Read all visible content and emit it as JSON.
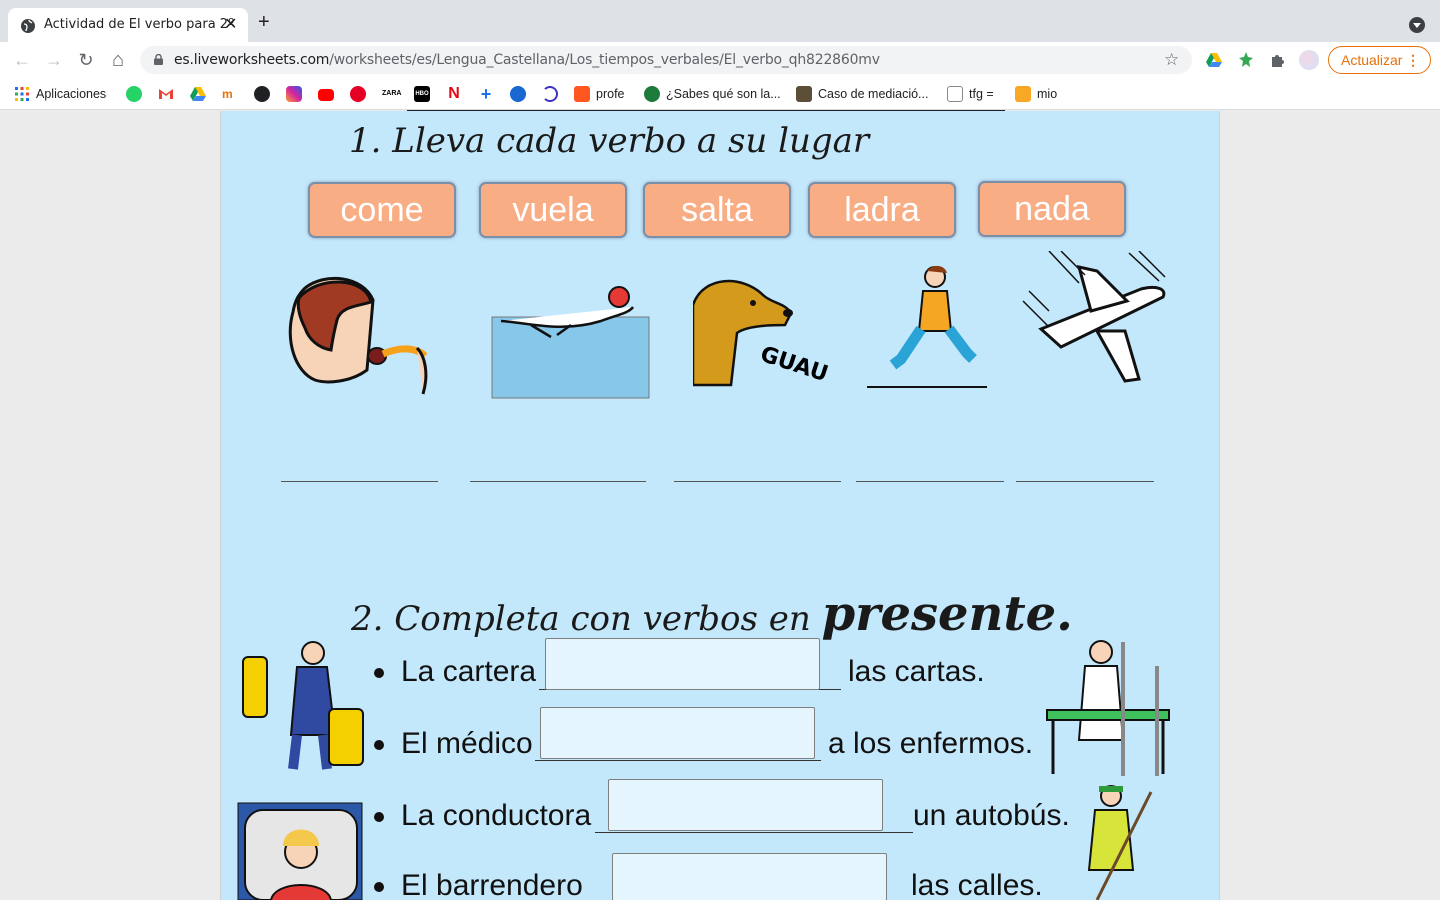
{
  "browser": {
    "tab_title": "Actividad de El verbo para 2º",
    "tab_close": "✕",
    "new_tab": "+",
    "url_host": "es.liveworksheets.com",
    "url_path": "/worksheets/es/Lengua_Castellana/Los_tiempos_verbales/El_verbo_qh822860mv",
    "update_label": "Actualizar",
    "update_menu": "⋮",
    "back_icon": "←",
    "forward_icon": "→",
    "reload_icon": "↻",
    "home_icon": "⌂",
    "star_icon": "☆"
  },
  "bookmarks": [
    {
      "label": "Aplicaciones",
      "icon": "apps-grid-icon"
    },
    {
      "label": "",
      "icon": "whatsapp-icon"
    },
    {
      "label": "",
      "icon": "gmail-icon"
    },
    {
      "label": "",
      "icon": "drive-icon"
    },
    {
      "label": "",
      "icon": "mtm-icon"
    },
    {
      "label": "",
      "icon": "compass-icon"
    },
    {
      "label": "",
      "icon": "instagram-icon"
    },
    {
      "label": "",
      "icon": "youtube-icon"
    },
    {
      "label": "",
      "icon": "pinterest-icon"
    },
    {
      "label": "",
      "icon": "zara-icon"
    },
    {
      "label": "",
      "icon": "hbo-icon"
    },
    {
      "label": "",
      "icon": "netflix-icon"
    },
    {
      "label": "",
      "icon": "plus-icon"
    },
    {
      "label": "",
      "icon": "play-icon"
    },
    {
      "label": "",
      "icon": "disney-icon"
    },
    {
      "label": "profe",
      "icon": "blogger-icon"
    },
    {
      "label": "¿Sabes qué son la...",
      "icon": "globe-icon"
    },
    {
      "label": "Caso de mediació...",
      "icon": "book-icon"
    },
    {
      "label": "tfg =",
      "icon": "doc-icon"
    },
    {
      "label": "mio",
      "icon": "blogger-icon"
    }
  ],
  "worksheet": {
    "title1": "1. Lleva cada verbo a su lugar",
    "verbs": [
      "come",
      "vuela",
      "salta",
      "ladra",
      "nada"
    ],
    "guau": "GUAU",
    "title2_prefix": "2. Completa con verbos en",
    "title2_emphasis": "presente.",
    "sentences": [
      {
        "before": "La cartera",
        "after": "las cartas."
      },
      {
        "before": "El médico",
        "after": "a los enfermos."
      },
      {
        "before": "La conductora",
        "after": "un autobús."
      },
      {
        "before": "El barrendero",
        "after": "las calles."
      }
    ]
  },
  "colors": {
    "sheet_bg": "#c4e8fb",
    "verb_button": "#f8ad85",
    "update_accent": "#e8710a"
  }
}
